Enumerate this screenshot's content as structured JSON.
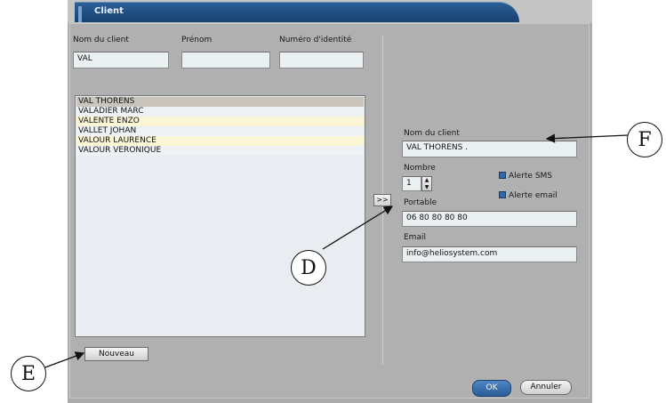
{
  "window": {
    "title": "Client"
  },
  "search": {
    "name_label": "Nom du client",
    "name_value": "VAL",
    "firstname_label": "Prénom",
    "firstname_value": "",
    "id_label": "Numéro d'identité",
    "id_value": ""
  },
  "client_list": [
    "VAL THORENS",
    "VALADIER MARC",
    "VALENTE ENZO",
    "VALLET JOHAN",
    "VALOUR LAURENCE",
    "VALOUR VERONIQUE"
  ],
  "transfer_button": ">>",
  "detail": {
    "name_label": "Nom du client",
    "name_value": "VAL THORENS .",
    "count_label": "Nombre",
    "count_value": "1",
    "sms_alert_label": "Alerte SMS",
    "email_alert_label": "Alerte email",
    "mobile_label": "Portable",
    "mobile_value": "06 80 80 80 80",
    "email_label": "Email",
    "email_value": "info@heliosystem.com"
  },
  "buttons": {
    "new": "Nouveau",
    "ok": "OK",
    "cancel": "Annuler"
  },
  "annotations": {
    "d": "D",
    "e": "E",
    "f": "F"
  }
}
